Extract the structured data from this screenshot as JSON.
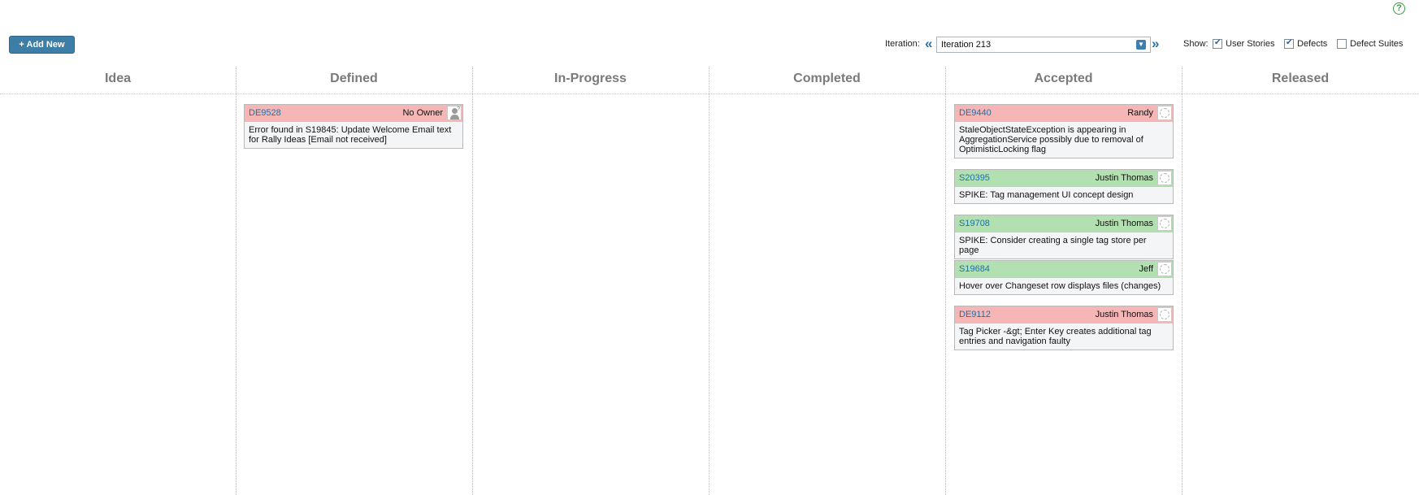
{
  "help": {
    "glyph": "?"
  },
  "toolbar": {
    "add_new_label": "+ Add New",
    "iteration_label": "Iteration:",
    "iteration_prev": "«",
    "iteration_next": "»",
    "iteration_value": "Iteration 213",
    "show_label": "Show:",
    "filters": [
      {
        "label": "User Stories",
        "checked": true
      },
      {
        "label": "Defects",
        "checked": true
      },
      {
        "label": "Defect Suites",
        "checked": false
      }
    ]
  },
  "columns": [
    {
      "title": "Idea"
    },
    {
      "title": "Defined"
    },
    {
      "title": "In-Progress"
    },
    {
      "title": "Completed"
    },
    {
      "title": "Accepted"
    },
    {
      "title": "Released"
    }
  ],
  "cards": {
    "defined": [
      {
        "id": "DE9528",
        "owner": "No Owner",
        "type": "defect",
        "avatar": "person-placeholder-icon",
        "description": "Error found in S19845: Update Welcome Email text for Rally Ideas [Email not received]"
      }
    ],
    "accepted": [
      {
        "id": "DE9440",
        "owner": "Randy",
        "type": "defect",
        "avatar": "user-avatar-icon",
        "description": "StaleObjectStateException is appearing in AggregationService possibly due to removal of OptimisticLocking flag"
      },
      {
        "id": "S20395",
        "owner": "Justin Thomas",
        "type": "story",
        "avatar": "user-avatar-icon",
        "description": "SPIKE: Tag management UI concept design"
      },
      {
        "id": "S19708",
        "owner": "Justin Thomas",
        "type": "story",
        "avatar": "user-avatar-icon",
        "description": "SPIKE: Consider creating a single tag store per page"
      },
      {
        "id": "S19684",
        "owner": "Jeff",
        "type": "story",
        "avatar": "user-avatar-icon",
        "description": "Hover over Changeset row displays files (changes)"
      },
      {
        "id": "DE9112",
        "owner": "Justin Thomas",
        "type": "defect",
        "avatar": "user-avatar-icon",
        "description": "Tag Picker -&gt; Enter Key creates additional tag entries and navigation faulty"
      }
    ]
  },
  "colors": {
    "defect_header": "#f7b6b6",
    "story_header": "#b2e0b0",
    "accent": "#3d7ea6",
    "link": "#1f6fa5"
  }
}
